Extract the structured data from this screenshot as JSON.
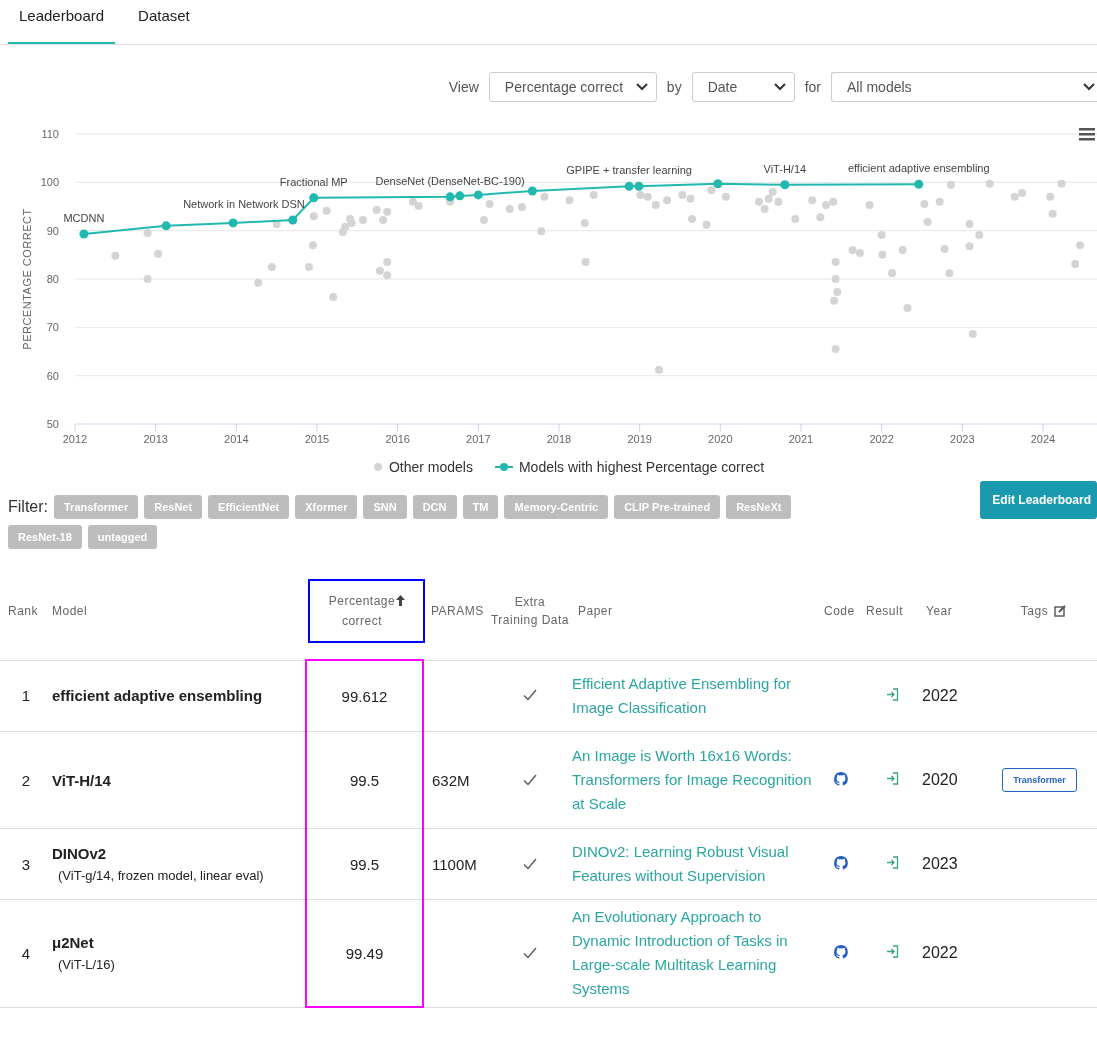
{
  "tabs": [
    {
      "label": "Leaderboard",
      "selected": true
    },
    {
      "label": "Dataset",
      "selected": false
    }
  ],
  "view_controls": {
    "view_label": "View",
    "view_value": "Percentage correct",
    "by_label": "by",
    "by_value": "Date",
    "for_label": "for",
    "for_value": "All models"
  },
  "chart": {
    "chart_data": {
      "type": "scatter",
      "grid": true,
      "legend": "bottom",
      "ylabel": "PERCENTAGE CORRECT",
      "xlim": [
        2012,
        2024.67
      ],
      "ylim": [
        50,
        110
      ],
      "xticks": [
        2012,
        2013,
        2014,
        2015,
        2016,
        2017,
        2018,
        2019,
        2020,
        2021,
        2022,
        2023,
        2024
      ],
      "yticks": [
        50,
        60,
        70,
        80,
        90,
        100,
        110
      ],
      "series": [
        {
          "name": "Other models",
          "type": "scatter",
          "color": "#d4d4d4",
          "x": [
            2012.5,
            2012.9,
            2012.9,
            2013.03,
            2014.27,
            2014.44,
            2014.5,
            2014.9,
            2014.95,
            2014.96,
            2015.12,
            2015.2,
            2015.32,
            2015.35,
            2015.41,
            2015.43,
            2015.57,
            2015.74,
            2015.82,
            2015.87,
            2015.78,
            2015.87,
            2015.87,
            2016.19,
            2016.26,
            2016.65,
            2017.07,
            2017.14,
            2017.39,
            2017.54,
            2017.78,
            2017.82,
            2018.13,
            2018.32,
            2018.33,
            2018.43,
            2019.01,
            2019.1,
            2019.2,
            2019.24,
            2019.34,
            2019.53,
            2019.65,
            2019.63,
            2019.83,
            2019.89,
            2020.07,
            2020.48,
            2020.55,
            2020.6,
            2020.65,
            2020.72,
            2020.93,
            2021.14,
            2021.24,
            2021.31,
            2021.4,
            2021.43,
            2021.43,
            2021.41,
            2021.45,
            2021.43,
            2021.64,
            2021.73,
            2021.85,
            2022.0,
            2022.01,
            2022.13,
            2022.26,
            2022.32,
            2022.53,
            2022.57,
            2022.72,
            2022.78,
            2022.84,
            2022.86,
            2023.09,
            2023.09,
            2023.13,
            2023.21,
            2023.34,
            2023.65,
            2023.74,
            2024.09,
            2024.12,
            2024.23,
            2024.4,
            2024.46
          ],
          "values": [
            84.8,
            89.5,
            80.0,
            85.2,
            79.2,
            82.5,
            91.4,
            82.5,
            87.0,
            93.0,
            94.1,
            76.3,
            89.7,
            90.8,
            92.4,
            91.6,
            92.2,
            94.3,
            92.2,
            93.9,
            81.7,
            83.5,
            80.8,
            96.0,
            95.1,
            96.0,
            92.2,
            95.5,
            94.5,
            94.9,
            89.9,
            97.0,
            96.3,
            91.6,
            83.5,
            97.4,
            97.4,
            97.0,
            95.3,
            61.2,
            96.3,
            97.4,
            92.4,
            96.6,
            91.2,
            98.4,
            97.0,
            96.0,
            94.5,
            96.6,
            98.0,
            96.0,
            92.4,
            96.3,
            92.8,
            95.3,
            96.0,
            83.5,
            80.0,
            75.5,
            77.3,
            65.5,
            86.0,
            85.4,
            95.3,
            89.1,
            85.0,
            81.2,
            86.0,
            74.0,
            95.5,
            91.8,
            96.0,
            86.2,
            81.2,
            99.5,
            91.4,
            86.8,
            68.6,
            89.1,
            99.7,
            97.0,
            97.8,
            97.0,
            93.5,
            99.7,
            83.1,
            87.0
          ]
        },
        {
          "name": "Models with highest Percentage correct",
          "type": "line",
          "marker": "circle",
          "color": "#21b8b0",
          "x": [
            2012.11,
            2013.13,
            2013.96,
            2014.7,
            2014.96,
            2016.65,
            2016.77,
            2017.0,
            2017.67,
            2018.87,
            2018.99,
            2019.97,
            2020.8,
            2022.46
          ],
          "values": [
            89.3,
            91.0,
            91.6,
            92.2,
            96.8,
            97.0,
            97.2,
            97.4,
            98.2,
            99.2,
            99.2,
            99.7,
            99.5,
            99.6
          ]
        }
      ],
      "annotations": [
        {
          "x": 2012.11,
          "y": 89.3,
          "text": "MCDNN"
        },
        {
          "x": 2014.7,
          "y": 92.2,
          "text": "Network in Network DSN"
        },
        {
          "x": 2014.96,
          "y": 96.8,
          "text": "Fractional MP"
        },
        {
          "x": 2016.65,
          "y": 97.0,
          "text": "DenseNet (DenseNet-BC-190)"
        },
        {
          "x": 2018.87,
          "y": 99.2,
          "text": "GPIPE + transfer learning"
        },
        {
          "x": 2020.8,
          "y": 99.5,
          "text": "ViT-H/14"
        },
        {
          "x": 2022.46,
          "y": 99.6,
          "text": "efficient adaptive ensembling"
        }
      ]
    }
  },
  "filter": {
    "label": "Filter:",
    "tags": [
      "Transformer",
      "ResNet",
      "EfficientNet",
      "Xformer",
      "SNN",
      "DCN",
      "TM",
      "Memory-Centric",
      "CLIP Pre-trained",
      "ResNeXt",
      "ResNet-18",
      "untagged"
    ],
    "edit_button": "Edit Leaderboard"
  },
  "table": {
    "columns": [
      {
        "label": "Rank",
        "outlined": false
      },
      {
        "label": "Model",
        "outlined": false
      },
      {
        "label": "Percentage correct",
        "sorted": true,
        "outlined": true
      },
      {
        "label": "PARAMS",
        "outlined": false
      },
      {
        "label": "Extra Training Data",
        "outlined": false
      },
      {
        "label": "Paper",
        "outlined": false
      },
      {
        "label": "Code",
        "outlined": false
      },
      {
        "label": "Result",
        "outlined": false
      },
      {
        "label": "Year",
        "outlined": false
      },
      {
        "label": "Tags",
        "editable": true,
        "outlined": false
      }
    ],
    "scores_outlined": true,
    "rows": [
      {
        "rank": "1",
        "model": "efficient adaptive ensembling",
        "value": "99.612",
        "params": "",
        "extra_training_data": true,
        "paper": "Efficient Adaptive Ensembling for Image Classification",
        "code": false,
        "year": "2022",
        "tags": []
      },
      {
        "rank": "2",
        "model": "ViT-H/14",
        "value": "99.5",
        "params": "632M",
        "extra_training_data": true,
        "paper": "An Image is Worth 16x16 Words: Transformers for Image Recognition at Scale",
        "code": true,
        "year": "2020",
        "tags": [
          "Transformer"
        ]
      },
      {
        "rank": "3",
        "model": "DINOv2",
        "model_detail": "(ViT-g/14, frozen model, linear eval)",
        "value": "99.5",
        "params": "1100M",
        "extra_training_data": true,
        "paper": "DINOv2: Learning Robust Visual Features without Supervision",
        "code": true,
        "year": "2023",
        "tags": []
      },
      {
        "rank": "4",
        "model": "μ2Net",
        "model_detail": "(ViT-L/16)",
        "value": "99.49",
        "params": "",
        "extra_training_data": true,
        "paper": "An Evolutionary Approach to Dynamic Introduction of Tasks in Large-scale Multitask Learning Systems",
        "code": true,
        "year": "2022",
        "tags": []
      }
    ]
  }
}
